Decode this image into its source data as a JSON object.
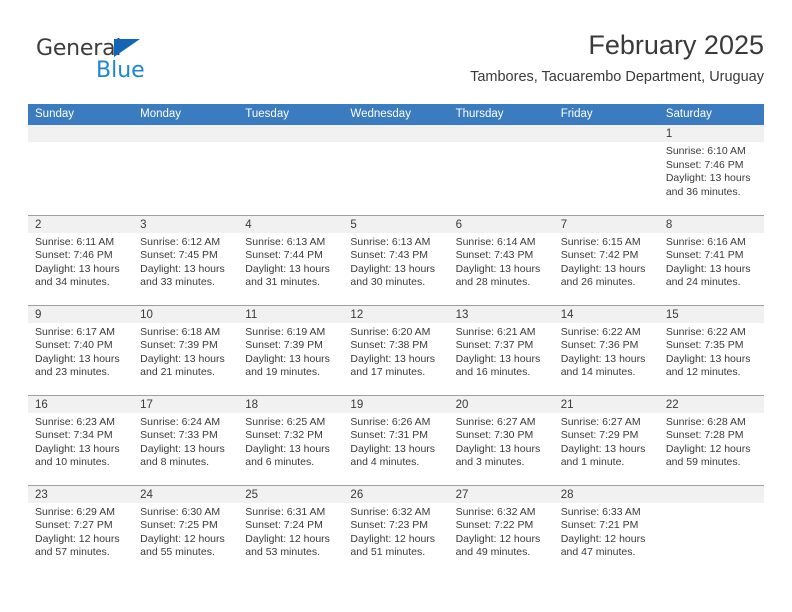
{
  "brand": {
    "name_top": "General",
    "name_bottom": "Blue",
    "color_dark": "#3c3c3c",
    "color_blue": "#1e86d6",
    "triangle_color": "#1266b5"
  },
  "header": {
    "title": "February 2025",
    "subtitle": "Tambores, Tacuarembo Department, Uruguay"
  },
  "theme": {
    "header_row_bg": "#3a7cbf",
    "header_row_text": "#ffffff",
    "daynum_band_bg": "#f1f1f1",
    "cell_bg": "#ffffff",
    "row_divider": "#9aa0a6",
    "text": "#3a3a3a"
  },
  "weekdays": [
    "Sunday",
    "Monday",
    "Tuesday",
    "Wednesday",
    "Thursday",
    "Friday",
    "Saturday"
  ],
  "labels": {
    "sunrise_prefix": "Sunrise:",
    "sunset_prefix": "Sunset:",
    "daylight_prefix": "Daylight:"
  },
  "weeks": [
    [
      {
        "day": "",
        "lines": []
      },
      {
        "day": "",
        "lines": []
      },
      {
        "day": "",
        "lines": []
      },
      {
        "day": "",
        "lines": []
      },
      {
        "day": "",
        "lines": []
      },
      {
        "day": "",
        "lines": []
      },
      {
        "day": "1",
        "lines": [
          "Sunrise: 6:10 AM",
          "Sunset: 7:46 PM",
          "Daylight: 13 hours",
          "and 36 minutes."
        ]
      }
    ],
    [
      {
        "day": "2",
        "lines": [
          "Sunrise: 6:11 AM",
          "Sunset: 7:46 PM",
          "Daylight: 13 hours",
          "and 34 minutes."
        ]
      },
      {
        "day": "3",
        "lines": [
          "Sunrise: 6:12 AM",
          "Sunset: 7:45 PM",
          "Daylight: 13 hours",
          "and 33 minutes."
        ]
      },
      {
        "day": "4",
        "lines": [
          "Sunrise: 6:13 AM",
          "Sunset: 7:44 PM",
          "Daylight: 13 hours",
          "and 31 minutes."
        ]
      },
      {
        "day": "5",
        "lines": [
          "Sunrise: 6:13 AM",
          "Sunset: 7:43 PM",
          "Daylight: 13 hours",
          "and 30 minutes."
        ]
      },
      {
        "day": "6",
        "lines": [
          "Sunrise: 6:14 AM",
          "Sunset: 7:43 PM",
          "Daylight: 13 hours",
          "and 28 minutes."
        ]
      },
      {
        "day": "7",
        "lines": [
          "Sunrise: 6:15 AM",
          "Sunset: 7:42 PM",
          "Daylight: 13 hours",
          "and 26 minutes."
        ]
      },
      {
        "day": "8",
        "lines": [
          "Sunrise: 6:16 AM",
          "Sunset: 7:41 PM",
          "Daylight: 13 hours",
          "and 24 minutes."
        ]
      }
    ],
    [
      {
        "day": "9",
        "lines": [
          "Sunrise: 6:17 AM",
          "Sunset: 7:40 PM",
          "Daylight: 13 hours",
          "and 23 minutes."
        ]
      },
      {
        "day": "10",
        "lines": [
          "Sunrise: 6:18 AM",
          "Sunset: 7:39 PM",
          "Daylight: 13 hours",
          "and 21 minutes."
        ]
      },
      {
        "day": "11",
        "lines": [
          "Sunrise: 6:19 AM",
          "Sunset: 7:39 PM",
          "Daylight: 13 hours",
          "and 19 minutes."
        ]
      },
      {
        "day": "12",
        "lines": [
          "Sunrise: 6:20 AM",
          "Sunset: 7:38 PM",
          "Daylight: 13 hours",
          "and 17 minutes."
        ]
      },
      {
        "day": "13",
        "lines": [
          "Sunrise: 6:21 AM",
          "Sunset: 7:37 PM",
          "Daylight: 13 hours",
          "and 16 minutes."
        ]
      },
      {
        "day": "14",
        "lines": [
          "Sunrise: 6:22 AM",
          "Sunset: 7:36 PM",
          "Daylight: 13 hours",
          "and 14 minutes."
        ]
      },
      {
        "day": "15",
        "lines": [
          "Sunrise: 6:22 AM",
          "Sunset: 7:35 PM",
          "Daylight: 13 hours",
          "and 12 minutes."
        ]
      }
    ],
    [
      {
        "day": "16",
        "lines": [
          "Sunrise: 6:23 AM",
          "Sunset: 7:34 PM",
          "Daylight: 13 hours",
          "and 10 minutes."
        ]
      },
      {
        "day": "17",
        "lines": [
          "Sunrise: 6:24 AM",
          "Sunset: 7:33 PM",
          "Daylight: 13 hours",
          "and 8 minutes."
        ]
      },
      {
        "day": "18",
        "lines": [
          "Sunrise: 6:25 AM",
          "Sunset: 7:32 PM",
          "Daylight: 13 hours",
          "and 6 minutes."
        ]
      },
      {
        "day": "19",
        "lines": [
          "Sunrise: 6:26 AM",
          "Sunset: 7:31 PM",
          "Daylight: 13 hours",
          "and 4 minutes."
        ]
      },
      {
        "day": "20",
        "lines": [
          "Sunrise: 6:27 AM",
          "Sunset: 7:30 PM",
          "Daylight: 13 hours",
          "and 3 minutes."
        ]
      },
      {
        "day": "21",
        "lines": [
          "Sunrise: 6:27 AM",
          "Sunset: 7:29 PM",
          "Daylight: 13 hours",
          "and 1 minute."
        ]
      },
      {
        "day": "22",
        "lines": [
          "Sunrise: 6:28 AM",
          "Sunset: 7:28 PM",
          "Daylight: 12 hours",
          "and 59 minutes."
        ]
      }
    ],
    [
      {
        "day": "23",
        "lines": [
          "Sunrise: 6:29 AM",
          "Sunset: 7:27 PM",
          "Daylight: 12 hours",
          "and 57 minutes."
        ]
      },
      {
        "day": "24",
        "lines": [
          "Sunrise: 6:30 AM",
          "Sunset: 7:25 PM",
          "Daylight: 12 hours",
          "and 55 minutes."
        ]
      },
      {
        "day": "25",
        "lines": [
          "Sunrise: 6:31 AM",
          "Sunset: 7:24 PM",
          "Daylight: 12 hours",
          "and 53 minutes."
        ]
      },
      {
        "day": "26",
        "lines": [
          "Sunrise: 6:32 AM",
          "Sunset: 7:23 PM",
          "Daylight: 12 hours",
          "and 51 minutes."
        ]
      },
      {
        "day": "27",
        "lines": [
          "Sunrise: 6:32 AM",
          "Sunset: 7:22 PM",
          "Daylight: 12 hours",
          "and 49 minutes."
        ]
      },
      {
        "day": "28",
        "lines": [
          "Sunrise: 6:33 AM",
          "Sunset: 7:21 PM",
          "Daylight: 12 hours",
          "and 47 minutes."
        ]
      },
      {
        "day": "",
        "lines": []
      }
    ]
  ]
}
